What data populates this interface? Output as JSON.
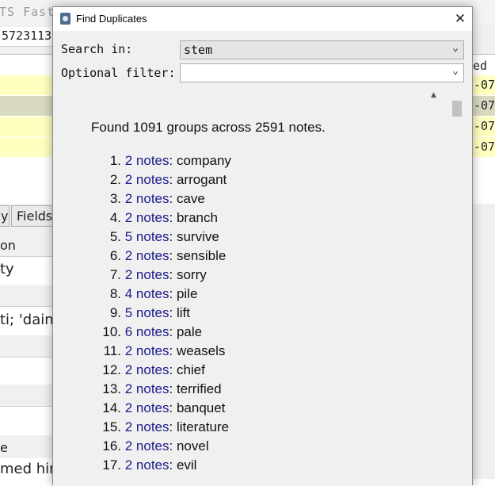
{
  "background": {
    "toolbar_text": "TS  Fast",
    "id_field": "5723113",
    "table_header_right": "ed",
    "rows": [
      {
        "value": "-07",
        "state": "yellow"
      },
      {
        "value": "-07",
        "state": "selected"
      },
      {
        "value": "-07",
        "state": "yellow"
      },
      {
        "value": "-07",
        "state": "yellow"
      }
    ],
    "buttons": [
      {
        "label": "y"
      },
      {
        "label": "Fields"
      }
    ],
    "fields": [
      {
        "label": "on"
      },
      {
        "value": "ty"
      },
      {
        "value": "ti; 'daino"
      },
      {
        "label": "e"
      },
      {
        "value": "med hin"
      }
    ]
  },
  "dialog": {
    "title": "Find Duplicates",
    "close_glyph": "✕",
    "search_in_label": "Search in:",
    "search_in_value": "stem",
    "optional_filter_label": "Optional filter:",
    "optional_filter_value": "",
    "chevron_glyph": "⌄",
    "summary": "Found 1091 groups across 2591 notes.",
    "groups": [
      {
        "num": "1.",
        "count": "2 notes",
        "word": "company"
      },
      {
        "num": "2.",
        "count": "2 notes",
        "word": "arrogant"
      },
      {
        "num": "3.",
        "count": "2 notes",
        "word": "cave"
      },
      {
        "num": "4.",
        "count": "2 notes",
        "word": "branch"
      },
      {
        "num": "5.",
        "count": "5 notes",
        "word": "survive"
      },
      {
        "num": "6.",
        "count": "2 notes",
        "word": "sensible"
      },
      {
        "num": "7.",
        "count": "2 notes",
        "word": "sorry"
      },
      {
        "num": "8.",
        "count": "4 notes",
        "word": "pile"
      },
      {
        "num": "9.",
        "count": "5 notes",
        "word": "lift"
      },
      {
        "num": "10.",
        "count": "6 notes",
        "word": "pale"
      },
      {
        "num": "11.",
        "count": "2 notes",
        "word": "weasels"
      },
      {
        "num": "12.",
        "count": "2 notes",
        "word": "chief"
      },
      {
        "num": "13.",
        "count": "2 notes",
        "word": "terrified"
      },
      {
        "num": "14.",
        "count": "2 notes",
        "word": "banquet"
      },
      {
        "num": "15.",
        "count": "2 notes",
        "word": "literature"
      },
      {
        "num": "16.",
        "count": "2 notes",
        "word": "novel"
      },
      {
        "num": "17.",
        "count": "2 notes",
        "word": "evil"
      }
    ],
    "colors": {
      "link": "#1a1a8c",
      "row_highlight": "#ffffc0",
      "row_selected": "#d9d9c0"
    }
  }
}
